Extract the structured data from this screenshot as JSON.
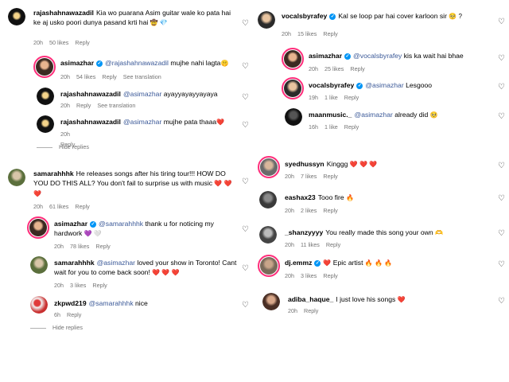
{
  "left": {
    "c1": {
      "user": "rajashahnawazadil",
      "text": "Kia wo puarana Asim guitar wale ko pata hai ke aj usko poori dunya pasand krti hai",
      "emoji": "🤠 💎",
      "time": "20h",
      "likes": "50 likes",
      "reply": "Reply"
    },
    "c1r1": {
      "user": "asimazhar",
      "mention": "@rajashahnawazadil",
      "text": "mujhe nahi lagta",
      "emoji": "🤫",
      "time": "20h",
      "likes": "54 likes",
      "reply": "Reply",
      "translate": "See translation"
    },
    "c1r2": {
      "user": "rajashahnawazadil",
      "mention": "@asimazhar",
      "text": "ayayyayayyayaya",
      "time": "20h",
      "reply": "Reply",
      "translate": "See translation"
    },
    "c1r3": {
      "user": "rajashahnawazadil",
      "mention": "@asimazhar",
      "text": "mujhe pata thaaa",
      "emoji": "❤️",
      "time": "20h",
      "reply": "Reply"
    },
    "hide1": "Hide replies",
    "c2": {
      "user": "samarahhhk",
      "text": "He releases songs after his tiring tour!!! HOW DO YOU DO THIS ALL? You don't fail to surprise us with music",
      "emoji": "❤️ ❤️ ❤️",
      "time": "20h",
      "likes": "61 likes",
      "reply": "Reply"
    },
    "c2r1": {
      "user": "asimazhar",
      "mention": "@samarahhhk",
      "text": "thank u for noticing my hardwork",
      "emoji": "💜 🤍",
      "time": "20h",
      "likes": "78 likes",
      "reply": "Reply"
    },
    "c2r2": {
      "user": "samarahhhk",
      "mention": "@asimazhar",
      "text": "loved your show in Toronto! Cant wait for you to come back soon!",
      "emoji": "❤️ ❤️ ❤️",
      "time": "20h",
      "likes": "3 likes",
      "reply": "Reply"
    },
    "c2r3": {
      "user": "zkpwd219",
      "mention": "@samarahhhk",
      "text": "nice",
      "time": "6h",
      "reply": "Reply"
    },
    "hide2": "Hide replies"
  },
  "right": {
    "c1": {
      "user": "vocalsbyrafey",
      "text": "Kal se loop par hai cover karloon sir",
      "emoji": "🥺 ?",
      "time": "20h",
      "likes": "15 likes",
      "reply": "Reply"
    },
    "c1r1": {
      "user": "asimazhar",
      "mention": "@vocalsbyrafey",
      "text": "kis ka wait hai bhae",
      "time": "20h",
      "likes": "25 likes",
      "reply": "Reply"
    },
    "c1r2": {
      "user": "vocalsbyrafey",
      "mention": "@asimazhar",
      "text": "Lesgooo",
      "time": "19h",
      "likes": "1 like",
      "reply": "Reply"
    },
    "c1r3": {
      "user": "maanmusic._",
      "mention": "@asimazhar",
      "text": "already did",
      "emoji": "🥺",
      "time": "16h",
      "likes": "1 like",
      "reply": "Reply"
    },
    "c2": {
      "user": "syedhussyn",
      "text": "Kinggg",
      "emoji": "❤️ ❤️ ❤️",
      "time": "20h",
      "likes": "7 likes",
      "reply": "Reply"
    },
    "c3": {
      "user": "eashax23",
      "text": "Tooo fire",
      "emoji": "🔥",
      "time": "20h",
      "likes": "2 likes",
      "reply": "Reply"
    },
    "c4": {
      "user": "_shanzyyyy",
      "text": "You really made this song your own",
      "emoji": "🫶",
      "time": "20h",
      "likes": "11 likes",
      "reply": "Reply"
    },
    "c5": {
      "user": "dj.emmz",
      "text": "Epic artist",
      "emoji": "🔥 🔥 🔥",
      "badge": "❤️",
      "time": "20h",
      "likes": "3 likes",
      "reply": "Reply"
    },
    "c6": {
      "user": "adiba_haque_",
      "text": "I just love his songs",
      "emoji": "❤️",
      "time": "20h",
      "reply": "Reply"
    }
  }
}
